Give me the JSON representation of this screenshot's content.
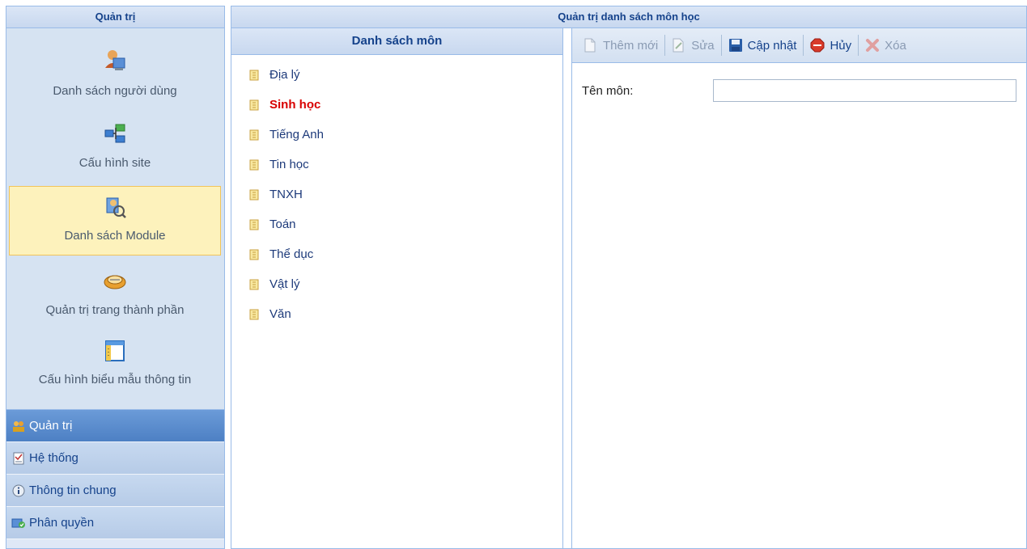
{
  "left_panel": {
    "title": "Quản trị",
    "launcher": [
      {
        "label": "Danh sách người dùng",
        "icon": "users-icon"
      },
      {
        "label": "Cấu hình site",
        "icon": "network-icon"
      },
      {
        "label": "Danh sách Module",
        "icon": "module-icon",
        "selected": true
      },
      {
        "label": "Quản trị trang thành phần",
        "icon": "component-icon"
      },
      {
        "label": "Cấu hình biểu mẫu thông tin",
        "icon": "form-icon"
      }
    ],
    "nav": [
      {
        "label": "Quản trị",
        "icon": "admin-icon",
        "active": true
      },
      {
        "label": "Hệ thống",
        "icon": "checklist-icon"
      },
      {
        "label": "Thông tin chung",
        "icon": "info-icon"
      },
      {
        "label": "Phân quyền",
        "icon": "permissions-icon"
      }
    ]
  },
  "main": {
    "title": "Quản trị danh sách môn học",
    "list_panel": {
      "title": "Danh sách môn",
      "items": [
        {
          "label": "Địa lý"
        },
        {
          "label": "Sinh học",
          "selected": true
        },
        {
          "label": "Tiếng Anh"
        },
        {
          "label": "Tin học"
        },
        {
          "label": "TNXH"
        },
        {
          "label": "Toán"
        },
        {
          "label": "Thể dục"
        },
        {
          "label": "Vật lý"
        },
        {
          "label": "Văn"
        }
      ]
    },
    "toolbar": {
      "add": {
        "label": "Thêm mới",
        "icon": "new-document-icon",
        "disabled": true
      },
      "edit": {
        "label": "Sửa",
        "icon": "edit-icon",
        "disabled": true
      },
      "update": {
        "label": "Cập nhật",
        "icon": "save-icon"
      },
      "cancel": {
        "label": "Hủy",
        "icon": "stop-icon"
      },
      "delete": {
        "label": "Xóa",
        "icon": "delete-icon",
        "disabled": true
      }
    },
    "form": {
      "subject_name_label": "Tên môn:",
      "subject_name_value": ""
    }
  },
  "colors": {
    "header_bg": "#c8d8ef",
    "border": "#99bbe8",
    "selected_launcher_bg": "#fdf2bc",
    "active_nav_bg": "#4d80c4",
    "selected_item_text": "#d80000"
  }
}
